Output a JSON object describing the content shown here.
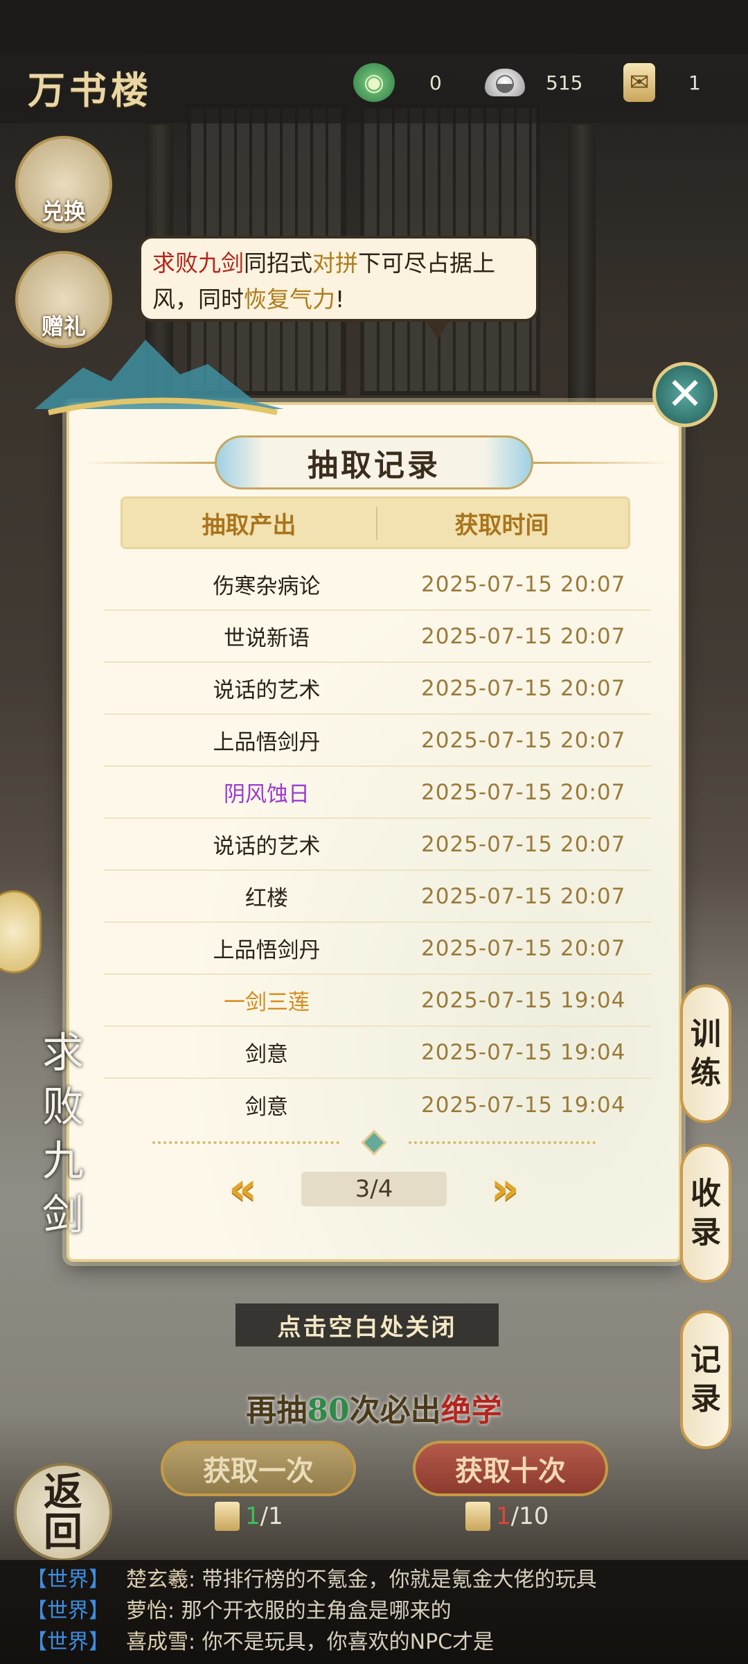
{
  "header": {
    "title": "万书楼",
    "resources": [
      {
        "icon": "jade-coin-icon",
        "value": "0"
      },
      {
        "icon": "silver-ingot-icon",
        "value": "515"
      },
      {
        "icon": "scroll-token-icon",
        "value": "1"
      }
    ]
  },
  "side_buttons": {
    "exchange": "兑换",
    "gift": "赠礼"
  },
  "bubble": {
    "p1": "求败九剑",
    "p2": "同招式",
    "p3": "对拼",
    "p4": "下可尽占据上风，同时",
    "p5": "恢复气力",
    "p6": "!"
  },
  "modal": {
    "title": "抽取记录",
    "col_item": "抽取产出",
    "col_time": "获取时间",
    "rows": [
      {
        "item": "伤寒杂病论",
        "time": "2025-07-15   20:07"
      },
      {
        "item": "世说新语",
        "time": "2025-07-15   20:07"
      },
      {
        "item": "说话的艺术",
        "time": "2025-07-15   20:07"
      },
      {
        "item": "上品悟剑丹",
        "time": "2025-07-15   20:07"
      },
      {
        "item": "阴风蚀日",
        "time": "2025-07-15   20:07"
      },
      {
        "item": "说话的艺术",
        "time": "2025-07-15   20:07"
      },
      {
        "item": "红楼",
        "time": "2025-07-15   20:07"
      },
      {
        "item": "上品悟剑丹",
        "time": "2025-07-15   20:07"
      },
      {
        "item": "一剑三莲",
        "time": "2025-07-15   19:04"
      },
      {
        "item": "剑意",
        "time": "2025-07-15   19:04"
      },
      {
        "item": "剑意",
        "time": "2025-07-15   19:04"
      }
    ],
    "page": "3/4",
    "prev": "«",
    "next": "»"
  },
  "right_tabs": [
    {
      "l1": "训",
      "l2": "练"
    },
    {
      "l1": "收",
      "l2": "录"
    },
    {
      "l1": "记",
      "l2": "录"
    }
  ],
  "side_title": {
    "c1": "求",
    "c2": "败",
    "c3": "九",
    "c4": "剑"
  },
  "hint": "点击空白处关闭",
  "promo": {
    "p1": "再抽",
    "count": "80",
    "p2": "次必出",
    "p3": "绝学"
  },
  "draw": {
    "once_label": "获取一次",
    "once_have": "1",
    "once_need": "/1",
    "ten_label": "获取十次",
    "ten_have": "1",
    "ten_need": "/10"
  },
  "back": {
    "l1": "返",
    "l2": "回"
  },
  "chat": [
    {
      "channel": "【世界】",
      "name": "楚玄羲",
      "text": ": 带排行榜的不氪金，你就是氪金大佬的玩具"
    },
    {
      "channel": "【世界】",
      "name": "萝怡",
      "text": ": 那个开衣服的主角盒是哪来的"
    },
    {
      "channel": "【世界】",
      "name": "喜成雪",
      "text": ": 你不是玩具，你喜欢的NPC才是"
    }
  ],
  "colors": {
    "accent_gold": "#b07b1c",
    "purple_rarity": "#9a3bd1",
    "orange_rarity": "#d58a19",
    "chat_channel": "#3d8de0"
  }
}
